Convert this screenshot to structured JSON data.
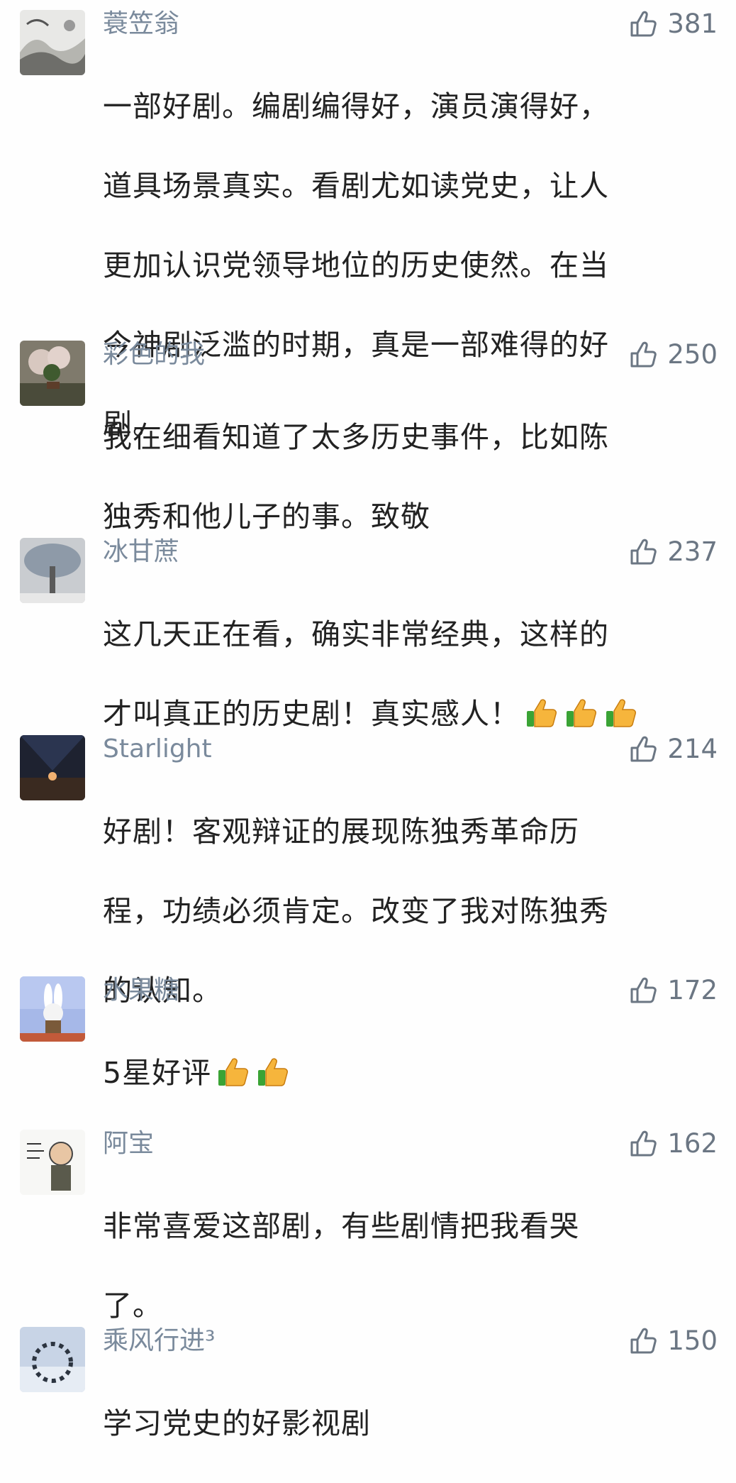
{
  "colors": {
    "name": "#7a8a9c",
    "text": "#222222",
    "like": "#6b7683",
    "background": "#fefefe"
  },
  "comments": [
    {
      "name": "蓑笠翁",
      "likes": "381",
      "lines": [
        "一部好剧。编剧编得好，演员演得好，",
        "道具场景真实。看剧尤如读党史，让人",
        "更加认识党领导地位的历史使然。在当",
        "今神剧泛滥的时期，真是一部难得的好",
        "剧。"
      ],
      "emoji_count": 0,
      "avatar": "ink-landscape-avatar"
    },
    {
      "name": "彩色的我",
      "likes": "250",
      "lines": [
        "我在细看知道了太多历史事件，比如陈",
        "独秀和他儿子的事。致敬"
      ],
      "emoji_count": 0,
      "avatar": "bonsai-avatar"
    },
    {
      "name": "冰甘蔗",
      "likes": "237",
      "lines": [
        "这几天正在看，确实非常经典，这样的",
        "才叫真正的历史剧！真实感人！"
      ],
      "emoji_count": 3,
      "avatar": "snow-tree-avatar"
    },
    {
      "name": "Starlight",
      "likes": "214",
      "lines": [
        "好剧！客观辩证的展现陈独秀革命历",
        "程，功绩必须肯定。改变了我对陈独秀",
        "的认知。"
      ],
      "emoji_count": 0,
      "avatar": "night-sky-avatar"
    },
    {
      "name": "水果糖",
      "likes": "172",
      "lines": [
        "5星好评"
      ],
      "emoji_count": 2,
      "avatar": "rabbit-avatar"
    },
    {
      "name": "阿宝",
      "likes": "162",
      "lines": [
        "非常喜爱这部剧，有些剧情把我看哭",
        "了。"
      ],
      "emoji_count": 0,
      "avatar": "cartoon-man-avatar"
    },
    {
      "name": "乘风行进³",
      "likes": "150",
      "lines": [
        "学习党史的好影视剧"
      ],
      "emoji_count": 0,
      "avatar": "group-circle-avatar"
    }
  ]
}
